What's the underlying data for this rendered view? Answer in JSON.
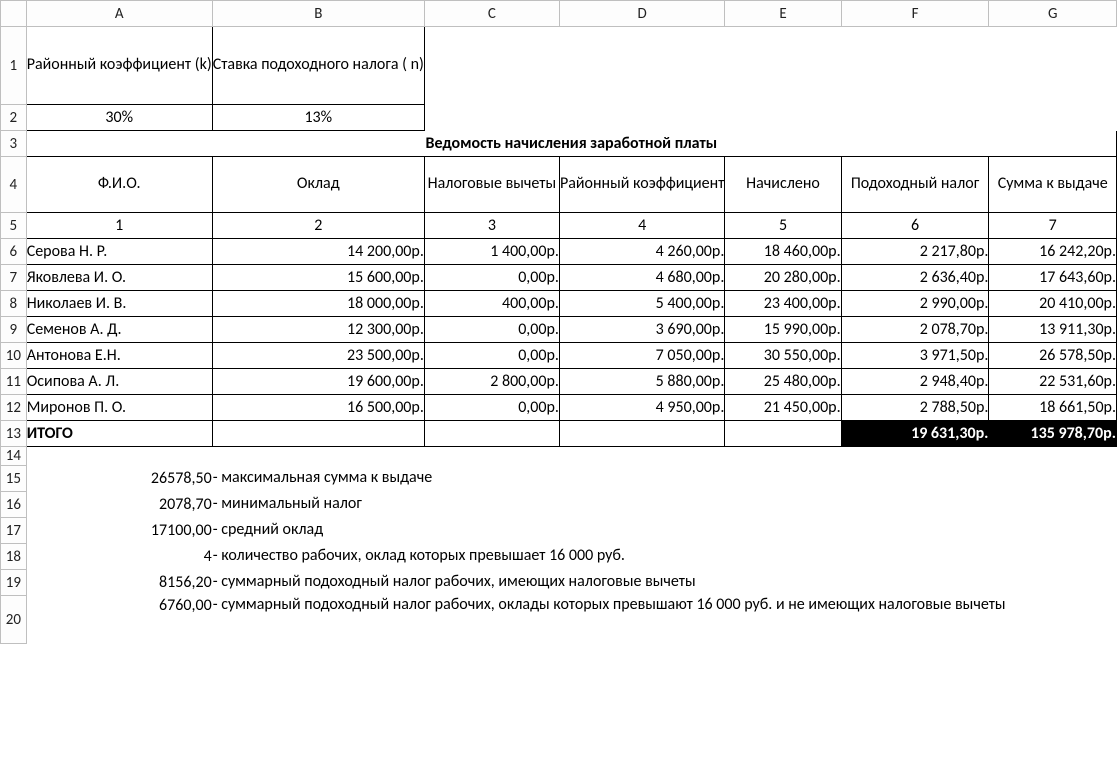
{
  "columns": [
    "A",
    "B",
    "C",
    "D",
    "E",
    "F",
    "G"
  ],
  "rows": [
    "1",
    "2",
    "3",
    "4",
    "5",
    "6",
    "7",
    "8",
    "9",
    "10",
    "11",
    "12",
    "13",
    "14",
    "15",
    "16",
    "17",
    "18",
    "19",
    "20"
  ],
  "params": {
    "k_label": "Районный коэффициент (k)",
    "n_label": "Ставка подоходного налога ( n)",
    "k_value": "30%",
    "n_value": "13%"
  },
  "title": "Ведомость начисления заработной платы",
  "headers": {
    "c1": "Ф.И.О.",
    "c2": "Оклад",
    "c3": "Налоговые вычеты",
    "c4": "Районный коэффициент",
    "c5": "Начислено",
    "c6": "Подоходный налог",
    "c7": "Сумма к выдаче"
  },
  "colnums": {
    "c1": "1",
    "c2": "2",
    "c3": "3",
    "c4": "4",
    "c5": "5",
    "c6": "6",
    "c7": "7"
  },
  "rowsData": [
    {
      "name": "Серова Н. Р.",
      "salary": "14 200,00р.",
      "deduct": "1 400,00р.",
      "kcoef": "4 260,00р.",
      "accr": "18 460,00р.",
      "tax": "2 217,80р.",
      "pay": "16 242,20р."
    },
    {
      "name": "Яковлева И. О.",
      "salary": "15 600,00р.",
      "deduct": "0,00р.",
      "kcoef": "4 680,00р.",
      "accr": "20 280,00р.",
      "tax": "2 636,40р.",
      "pay": "17 643,60р."
    },
    {
      "name": "Николаев И. В.",
      "salary": "18 000,00р.",
      "deduct": "400,00р.",
      "kcoef": "5 400,00р.",
      "accr": "23 400,00р.",
      "tax": "2 990,00р.",
      "pay": "20 410,00р."
    },
    {
      "name": "Семенов А. Д.",
      "salary": "12 300,00р.",
      "deduct": "0,00р.",
      "kcoef": "3 690,00р.",
      "accr": "15 990,00р.",
      "tax": "2 078,70р.",
      "pay": "13 911,30р."
    },
    {
      "name": "Антонова Е.Н.",
      "salary": "23 500,00р.",
      "deduct": "0,00р.",
      "kcoef": "7 050,00р.",
      "accr": "30 550,00р.",
      "tax": "3 971,50р.",
      "pay": "26 578,50р."
    },
    {
      "name": "Осипова А. Л.",
      "salary": "19 600,00р.",
      "deduct": "2 800,00р.",
      "kcoef": "5 880,00р.",
      "accr": "25 480,00р.",
      "tax": "2 948,40р.",
      "pay": "22 531,60р."
    },
    {
      "name": "Миронов П. О.",
      "salary": "16 500,00р.",
      "deduct": "0,00р.",
      "kcoef": "4 950,00р.",
      "accr": "21 450,00р.",
      "tax": "2 788,50р.",
      "pay": "18 661,50р."
    }
  ],
  "totals": {
    "label": "ИТОГО",
    "tax": "19 631,30р.",
    "pay": "135 978,70р."
  },
  "stats": [
    {
      "val": "26578,50",
      "txt": "- максимальная сумма к выдаче"
    },
    {
      "val": "2078,70",
      "txt": "- минимальный налог"
    },
    {
      "val": "17100,00",
      "txt": "- средний оклад"
    },
    {
      "val": "4",
      "txt": "- количество рабочих, оклад которых превышает 16 000 руб."
    },
    {
      "val": "8156,20",
      "txt": "- суммарный подоходный налог рабочих, имеющих налоговые вычеты"
    },
    {
      "val": "6760,00",
      "txt": "- суммарный подоходный налог рабочих, оклады которых превышают 16 000 руб. и не имеющих налоговые вычеты"
    }
  ]
}
